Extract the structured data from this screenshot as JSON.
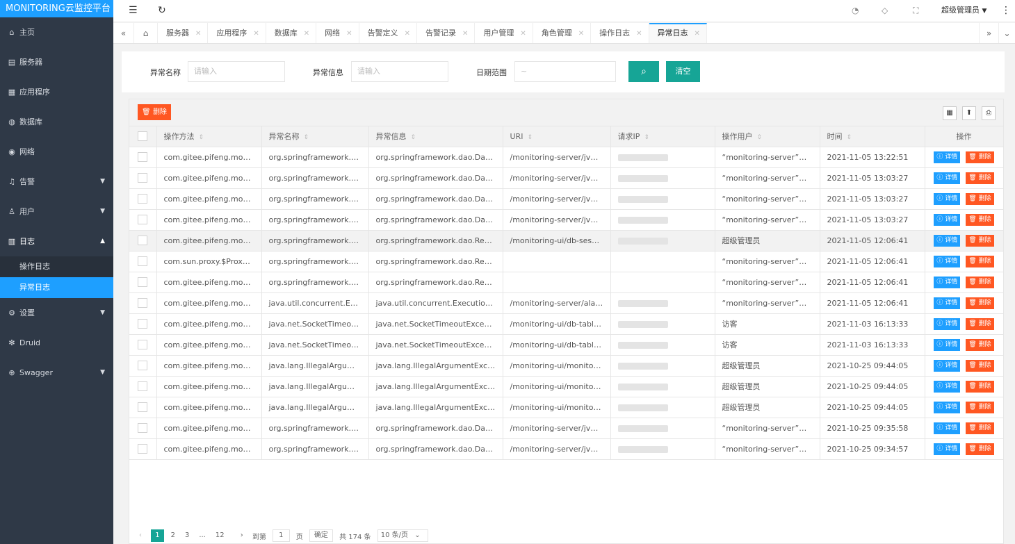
{
  "app_title": "MONITORING云监控平台",
  "sidebar": {
    "items": [
      {
        "icon": "⌂",
        "label": "主页"
      },
      {
        "icon": "▤",
        "label": "服务器"
      },
      {
        "icon": "▦",
        "label": "应用程序"
      },
      {
        "icon": "◍",
        "label": "数据库"
      },
      {
        "icon": "◉",
        "label": "网络"
      },
      {
        "icon": "♫",
        "label": "告警"
      },
      {
        "icon": "♙",
        "label": "用户"
      },
      {
        "icon": "▥",
        "label": "日志"
      }
    ],
    "log_sub": [
      "操作日志",
      "异常日志"
    ],
    "items2": [
      {
        "icon": "⚙",
        "label": "设置"
      },
      {
        "icon": "✻",
        "label": "Druid"
      },
      {
        "icon": "⊕",
        "label": "Swagger"
      }
    ]
  },
  "header": {
    "menu_icon": "☰",
    "refresh_icon": "↻",
    "user": "超级管理员",
    "more_icon": "⋮"
  },
  "tabs": [
    "服务器",
    "应用程序",
    "数据库",
    "网络",
    "告警定义",
    "告警记录",
    "用户管理",
    "角色管理",
    "操作日志",
    "异常日志"
  ],
  "search": {
    "name_label": "异常名称",
    "name_placeholder": "请输入",
    "info_label": "异常信息",
    "info_placeholder": "请输入",
    "date_label": "日期范围",
    "date_placeholder": "~",
    "search_icon": "⌕",
    "clear_label": "清空"
  },
  "toolbar": {
    "delete_label": "删除"
  },
  "table": {
    "headers": [
      "操作方法",
      "异常名称",
      "异常信息",
      "URI",
      "请求IP",
      "操作用户",
      "时间",
      "操作"
    ],
    "detail_label": "ⓘ 详情",
    "delete_label": "删除",
    "rows": [
      {
        "method": "com.gitee.pifeng.monito...",
        "name": "org.springframework.dao...",
        "info": "org.springframework.dao.DataInt...",
        "uri": "/monitoring-server/jvm/a...",
        "user": "“monitoring-server”服务",
        "time": "2021-11-05 13:22:51"
      },
      {
        "method": "com.gitee.pifeng.monito...",
        "name": "org.springframework.dao...",
        "info": "org.springframework.dao.DataInt...",
        "uri": "/monitoring-server/jvm/a...",
        "user": "“monitoring-server”服务",
        "time": "2021-11-05 13:03:27"
      },
      {
        "method": "com.gitee.pifeng.monito...",
        "name": "org.springframework.dao...",
        "info": "org.springframework.dao.DataInt...",
        "uri": "/monitoring-server/jvm/a...",
        "user": "“monitoring-server”服务",
        "time": "2021-11-05 13:03:27"
      },
      {
        "method": "com.gitee.pifeng.monito...",
        "name": "org.springframework.dao...",
        "info": "org.springframework.dao.DataInt...",
        "uri": "/monitoring-server/jvm/a...",
        "user": "“monitoring-server”服务",
        "time": "2021-11-05 13:03:27"
      },
      {
        "method": "com.gitee.pifeng.monito...",
        "name": "org.springframework.dao...",
        "info": "org.springframework.dao.Recov...",
        "uri": "/monitoring-ui/db-sessio...",
        "user": "超级管理员",
        "time": "2021-11-05 12:06:41"
      },
      {
        "method": "com.sun.proxy.$Proxy1...",
        "name": "org.springframework.dao...",
        "info": "org.springframework.dao.Recov...",
        "uri": "",
        "user": "“monitoring-server”服务",
        "time": "2021-11-05 12:06:41"
      },
      {
        "method": "com.gitee.pifeng.monito...",
        "name": "org.springframework.dao...",
        "info": "org.springframework.dao.Recov...",
        "uri": "",
        "user": "“monitoring-server”服务",
        "time": "2021-11-05 12:06:41"
      },
      {
        "method": "com.gitee.pifeng.monito...",
        "name": "java.util.concurrent.Exec...",
        "info": "java.util.concurrent.ExecutionEx...",
        "uri": "/monitoring-server/alarm/...",
        "user": "“monitoring-server”服务",
        "time": "2021-11-05 12:06:41"
      },
      {
        "method": "com.gitee.pifeng.monito...",
        "name": "java.net.SocketTimeoutE...",
        "info": "java.net.SocketTimeoutExceptio...",
        "uri": "/monitoring-ui/db-tablesp...",
        "user": "访客",
        "time": "2021-11-03 16:13:33"
      },
      {
        "method": "com.gitee.pifeng.monito...",
        "name": "java.net.SocketTimeoutE...",
        "info": "java.net.SocketTimeoutExceptio...",
        "uri": "/monitoring-ui/db-tablesp...",
        "user": "访客",
        "time": "2021-11-03 16:13:33"
      },
      {
        "method": "com.gitee.pifeng.monito...",
        "name": "java.lang.IllegalArgumen...",
        "info": "java.lang.IllegalArgumentExcepti...",
        "uri": "/monitoring-ui/monitor-jv...",
        "user": "超级管理员",
        "time": "2021-10-25 09:44:05"
      },
      {
        "method": "com.gitee.pifeng.monito...",
        "name": "java.lang.IllegalArgumen...",
        "info": "java.lang.IllegalArgumentExcepti...",
        "uri": "/monitoring-ui/monitor-jv...",
        "user": "超级管理员",
        "time": "2021-10-25 09:44:05"
      },
      {
        "method": "com.gitee.pifeng.monito...",
        "name": "java.lang.IllegalArgumen...",
        "info": "java.lang.IllegalArgumentExcepti...",
        "uri": "/monitoring-ui/monitor-jv...",
        "user": "超级管理员",
        "time": "2021-10-25 09:44:05"
      },
      {
        "method": "com.gitee.pifeng.monito...",
        "name": "org.springframework.dao...",
        "info": "org.springframework.dao.DataInt...",
        "uri": "/monitoring-server/jvm/a...",
        "user": "“monitoring-server”服务",
        "time": "2021-10-25 09:35:58"
      },
      {
        "method": "com.gitee.pifeng.monito...",
        "name": "org.springframework.dao...",
        "info": "org.springframework.dao.DataInt...",
        "uri": "/monitoring-server/jvm/a...",
        "user": "“monitoring-server”服务",
        "time": "2021-10-25 09:34:57"
      }
    ]
  },
  "pager": {
    "pages": [
      "1",
      "2",
      "3",
      "...",
      "12"
    ],
    "goto": "到第",
    "page_value": "1",
    "page_unit": "页",
    "confirm": "确定",
    "total": "共 174 条",
    "size": "10 条/页"
  },
  "colors": {
    "accent": "#1e9fff",
    "green": "#16a596",
    "danger": "#ff5722",
    "sidebar": "#2f3947"
  }
}
